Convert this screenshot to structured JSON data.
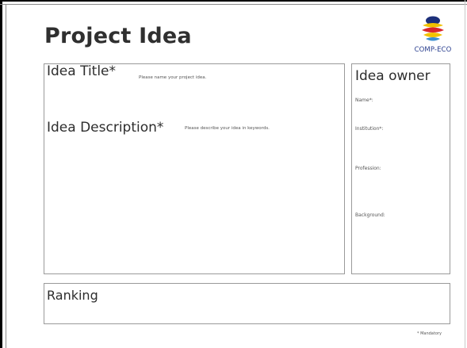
{
  "document": {
    "title": "Project Idea",
    "logo_text": "COMP-ECO",
    "idea_section": {
      "title_label": "Idea Title*",
      "title_hint": "Please name your project idea.",
      "description_label": "Idea Description*",
      "description_hint": "Please describe your idea in keywords."
    },
    "owner_section": {
      "heading": "Idea owner",
      "fields": [
        "Name*:",
        "Institution*:",
        "Profession:",
        "Background:"
      ]
    },
    "ranking_section": {
      "heading": "Ranking"
    },
    "mandatory_note": "* Mandatory"
  },
  "colors": {
    "logo_yellow": "#f2c200",
    "logo_red": "#d9262c",
    "logo_blue": "#2a3f8f",
    "border": "#9a9a9a"
  }
}
